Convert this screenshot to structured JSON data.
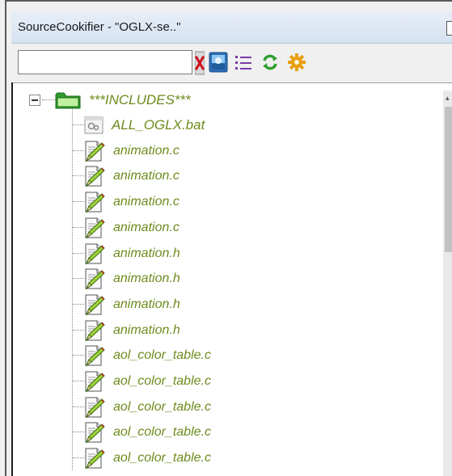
{
  "window": {
    "title": "SourceCookifier - \"OGLX-se..\""
  },
  "toolbar": {
    "search_value": "",
    "search_placeholder": "",
    "icons": {
      "clear": "clear-x-icon",
      "file": "file-view-icon",
      "list": "list-view-icon",
      "refresh": "refresh-icon",
      "settings": "settings-gear-icon"
    }
  },
  "tree": {
    "root": {
      "label": "***INCLUDES***",
      "expanded": true,
      "icon": "folder-icon"
    },
    "items": [
      {
        "label": "ALL_OGLX.bat",
        "icon": "batch-file-icon"
      },
      {
        "label": "animation.c",
        "icon": "source-file-icon"
      },
      {
        "label": "animation.c",
        "icon": "source-file-icon"
      },
      {
        "label": "animation.c",
        "icon": "source-file-icon"
      },
      {
        "label": "animation.c",
        "icon": "source-file-icon"
      },
      {
        "label": "animation.h",
        "icon": "source-file-icon"
      },
      {
        "label": "animation.h",
        "icon": "source-file-icon"
      },
      {
        "label": "animation.h",
        "icon": "source-file-icon"
      },
      {
        "label": "animation.h",
        "icon": "source-file-icon"
      },
      {
        "label": "aol_color_table.c",
        "icon": "source-file-icon"
      },
      {
        "label": "aol_color_table.c",
        "icon": "source-file-icon"
      },
      {
        "label": "aol_color_table.c",
        "icon": "source-file-icon"
      },
      {
        "label": "aol_color_table.c",
        "icon": "source-file-icon"
      },
      {
        "label": "aol_color_table.c",
        "icon": "source-file-icon"
      }
    ]
  },
  "colors": {
    "label_green": "#6d8b1c",
    "titlebar": "#dbe5f3",
    "background": "#f0f0f0"
  }
}
